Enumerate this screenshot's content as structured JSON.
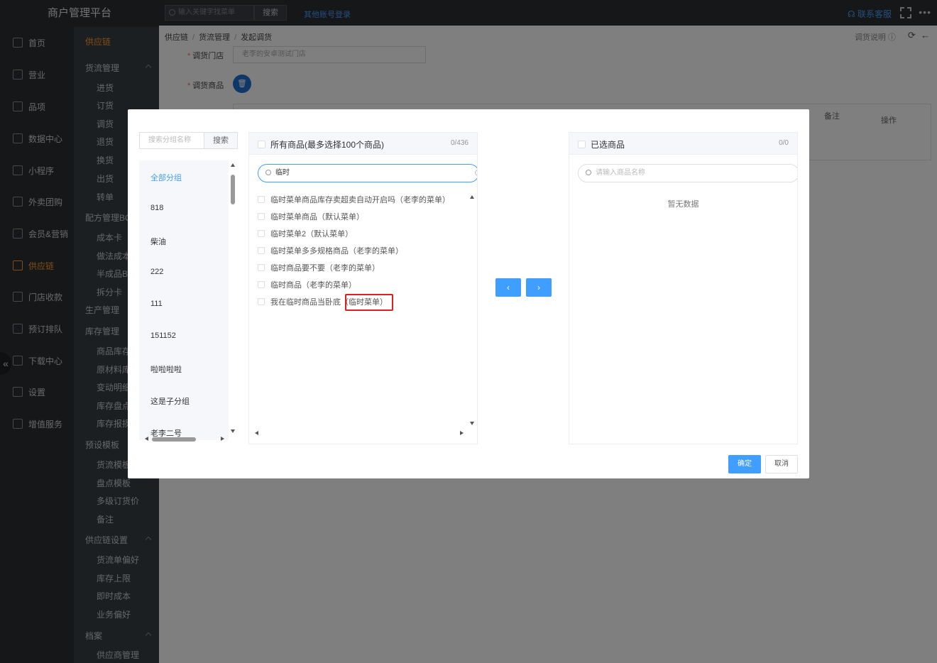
{
  "app": {
    "title": "商户管理平台"
  },
  "topbar": {
    "search_placeholder": "输入关键字找菜单",
    "search_button": "搜索",
    "other_login": "其他账号登录",
    "contact": "联系客服",
    "more": "•••"
  },
  "nav": [
    {
      "label": "首页",
      "icon": "home-icon"
    },
    {
      "label": "营业",
      "icon": "calendar-icon"
    },
    {
      "label": "品项",
      "icon": "bag-icon"
    },
    {
      "label": "数据中心",
      "icon": "share-icon"
    },
    {
      "label": "小程序",
      "icon": "phone-icon"
    },
    {
      "label": "外卖团购",
      "icon": "group-icon"
    },
    {
      "label": "会员&营销",
      "icon": "user-icon"
    },
    {
      "label": "供应链",
      "icon": "truck-icon"
    },
    {
      "label": "门店收款",
      "icon": "coin-icon"
    },
    {
      "label": "预订排队",
      "icon": "clock-icon"
    },
    {
      "label": "下载中心",
      "icon": "download-icon"
    },
    {
      "label": "设置",
      "icon": "gear-icon"
    },
    {
      "label": "增值服务",
      "icon": "alarm-icon"
    }
  ],
  "submenu": {
    "header": "供应链",
    "sections": [
      {
        "title": "货流管理",
        "items": [
          "进货",
          "订货",
          "调货",
          "退货",
          "换货",
          "出货",
          "转单"
        ]
      },
      {
        "title": "配方管理BOM",
        "items": [
          "成本卡",
          "做法成本卡",
          "半成品BOM",
          "拆分卡"
        ]
      },
      {
        "title": "生产管理",
        "items": []
      },
      {
        "title": "库存管理",
        "items": [
          "商品库存",
          "原材料库存",
          "变动明细",
          "库存盘点",
          "库存报损"
        ]
      },
      {
        "title": "预设模板",
        "items": [
          "货流模板",
          "盘点模板",
          "多级订货价",
          "备注"
        ]
      },
      {
        "title": "供应链设置",
        "items": [
          "货流单偏好",
          "库存上限",
          "即时成本",
          "业务偏好"
        ]
      },
      {
        "title": "档案",
        "items": [
          "供应商管理"
        ]
      }
    ]
  },
  "page": {
    "breadcrumb": [
      "供应链",
      "货流管理",
      "发起调货"
    ],
    "doc_link": "调货说明",
    "store_label": "调货门店",
    "store_value": "老李的安卓测试门店",
    "goods_label": "调货商品",
    "table_headers": [
      "备注",
      "操作"
    ]
  },
  "modal": {
    "group_search_placeholder": "搜索分组名称",
    "group_search_button": "搜索",
    "groups": [
      "全部分组",
      "818",
      "柴油",
      "222",
      "111",
      "151152",
      "啦啦啦啦",
      "这是子分组",
      "老李二号"
    ],
    "left_panel": {
      "title": "所有商品(最多选择100个商品)",
      "count": "0/436",
      "filter_value": "临时",
      "items": [
        "临时菜单商品库存卖超卖自动开启吗（老李的菜单）",
        "临时菜单商品（默认菜单）",
        "临时菜单2（默认菜单）",
        "临时菜单多多规格商品（老李的菜单）",
        "临时商品要不要（老李的菜单）",
        "临时商品（老李的菜单）",
        "我在临时商品当卧底（临时菜单）"
      ]
    },
    "right_panel": {
      "title": "已选商品",
      "count": "0/0",
      "filter_placeholder": "请输入商品名称",
      "empty_text": "暂无数据"
    },
    "buttons": {
      "left": "‹",
      "right": "›",
      "ok": "确定",
      "cancel": "取消"
    }
  },
  "colors": {
    "primary": "#409eff",
    "accent": "#ff9a2e",
    "sidebar": "#2b2f33",
    "highlight": "#e02020"
  }
}
